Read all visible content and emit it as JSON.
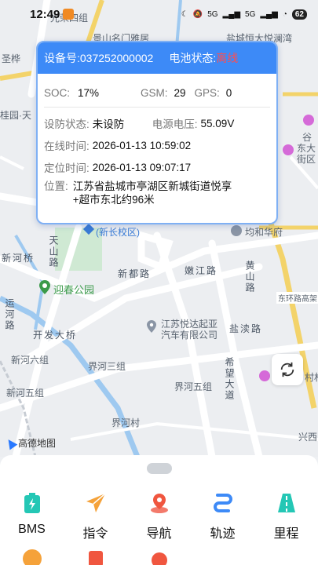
{
  "status_bar": {
    "time": "12:49",
    "battery": "62",
    "net1": "5G",
    "net2": "5G"
  },
  "map": {
    "labels": {
      "l1": "光荣四组",
      "l2": "景山名门雅居",
      "l3": "盐城恒大悦澜湾",
      "l4": "圣桦",
      "l5": "桂园·天",
      "l6": "谷",
      "l7": "东大",
      "l8": "街区",
      "l9": "(新长校区)",
      "l10": "均和华府",
      "l11": "天山路",
      "l12": "新河桥",
      "l13": "新都路",
      "l14": "嫩江路",
      "l15": "黄山路",
      "l16": "迎春公园",
      "l17": "东环路高架",
      "l18": "运河路",
      "l19": "开发大桥",
      "l20": "江苏悦达起亚",
      "l21": "汽车有限公司",
      "l22": "盐渎路",
      "l23": "新河六组",
      "l24": "界河三组",
      "l25": "希望大道",
      "l26": "界河五组",
      "l27": "新河五组",
      "l28": "界河村",
      "l29": "兴西",
      "l30": "村材"
    },
    "logo_text": "高德地图"
  },
  "card": {
    "device_label": "设备号:",
    "device_no": "037252000002",
    "battery_state_label": "电池状态:",
    "battery_state": "离线",
    "soc_label": "SOC:",
    "soc": "17%",
    "gsm_label": "GSM:",
    "gsm": "29",
    "gps_label": "GPS:",
    "gps": "0",
    "arm_label": "设防状态:",
    "arm": "未设防",
    "voltage_label": "电源电压:",
    "voltage": "55.09V",
    "online_label": "在线时间:",
    "online": "2026-01-13 10:59:02",
    "locate_label": "定位时间:",
    "locate": "2026-01-13 09:07:17",
    "addr_label": "位置:",
    "addr": "江苏省盐城市亭湖区新城街道悦享+超市东北约96米"
  },
  "menu": [
    {
      "label": "BMS",
      "icon": "battery-icon"
    },
    {
      "label": "指令",
      "icon": "send-icon"
    },
    {
      "label": "导航",
      "icon": "navigation-pin-icon"
    },
    {
      "label": "轨迹",
      "icon": "track-icon"
    },
    {
      "label": "里程",
      "icon": "road-icon"
    }
  ],
  "colors": {
    "accent": "#3d8af7",
    "offline": "#ff4d4f",
    "park": "#3a9a4a"
  }
}
